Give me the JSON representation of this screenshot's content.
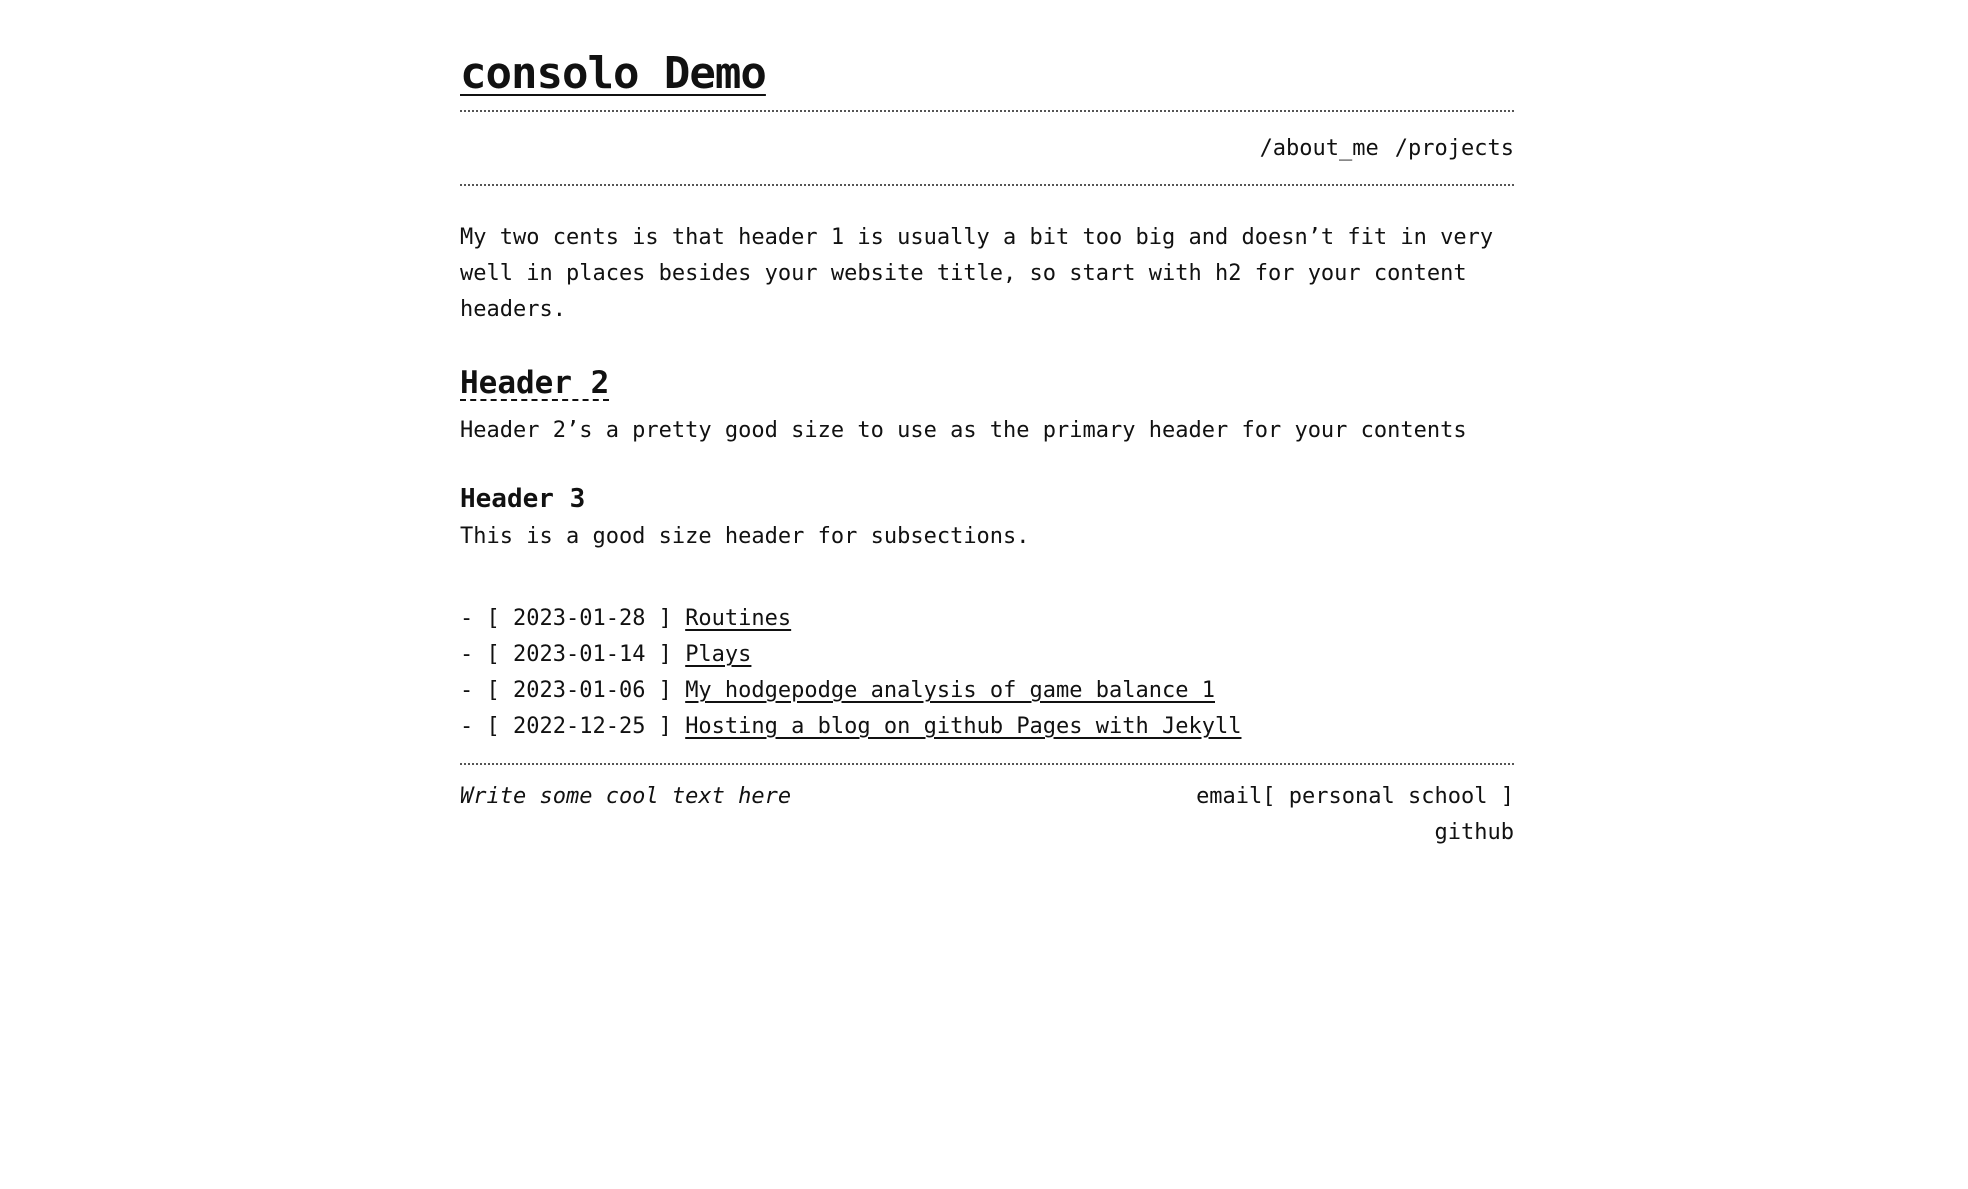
{
  "site": {
    "title": "consolo Demo"
  },
  "nav": {
    "items": [
      {
        "label": "/about_me"
      },
      {
        "label": "/projects"
      }
    ]
  },
  "intro": {
    "text": "My two cents is that header 1 is usually a bit too big and doesn’t fit in very well in places besides your website title, so start with h2 for your content headers."
  },
  "section_h2": {
    "title": "Header 2",
    "text": "Header 2’s a pretty good size to use as the primary header for your contents"
  },
  "section_h3": {
    "title": "Header 3",
    "text": "This is a good size header for subsections."
  },
  "posts": [
    {
      "prefix": "- [ ",
      "date": "2023-01-28",
      "suffix": " ] ",
      "title": "Routines"
    },
    {
      "prefix": "- [ ",
      "date": "2023-01-14",
      "suffix": " ] ",
      "title": "Plays"
    },
    {
      "prefix": "- [ ",
      "date": "2023-01-06",
      "suffix": " ] ",
      "title": "My hodgepodge analysis of game balance 1"
    },
    {
      "prefix": "- [ ",
      "date": "2022-12-25",
      "suffix": " ] ",
      "title": "Hosting a blog on github Pages with Jekyll"
    }
  ],
  "footer": {
    "tagline": "Write some cool text here",
    "email_label": "email[",
    "personal_label": "personal",
    "school_label": "school",
    "email_close": "]",
    "github_label": "github"
  }
}
